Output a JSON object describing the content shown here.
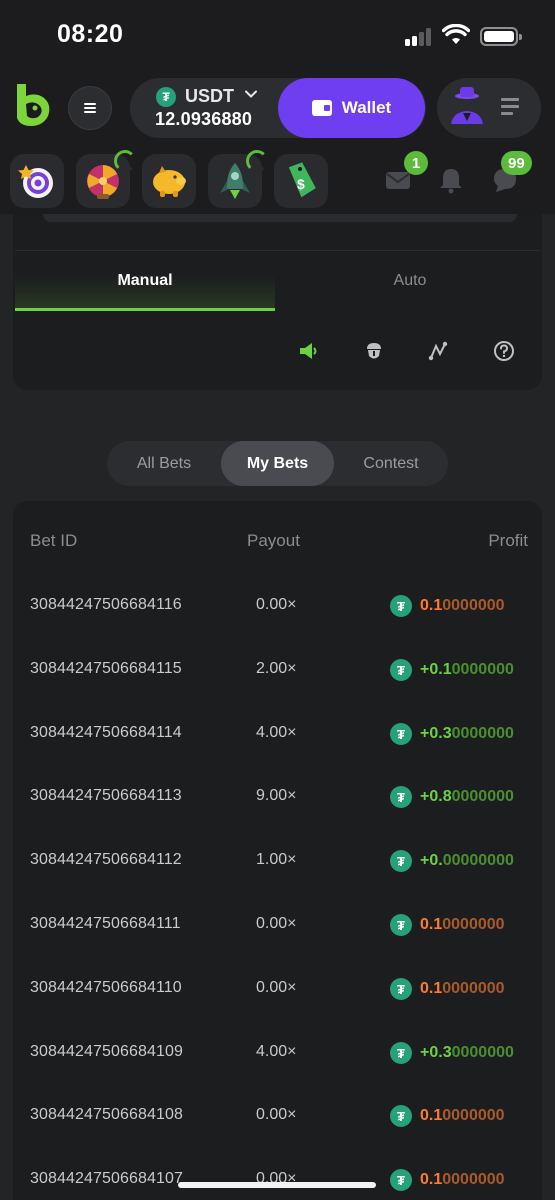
{
  "status_bar": {
    "time": "08:20"
  },
  "header": {
    "currency": "USDT",
    "balance": "12.0936880",
    "wallet_label": "Wallet",
    "colors": {
      "wallet": "#6f3ef0",
      "accent": "#6bd33f"
    }
  },
  "promos": {
    "icons": [
      "target-icon",
      "lucky-wheel-icon",
      "piggy-bank-icon",
      "rocket-icon",
      "price-tag-icon"
    ],
    "mail_badge": "1",
    "chat_badge": "99"
  },
  "game_panel": {
    "tabs": [
      {
        "label": "Manual",
        "active": true
      },
      {
        "label": "Auto",
        "active": false
      }
    ],
    "tools": [
      "sound-icon",
      "fairness-icon",
      "chart-icon",
      "help-icon"
    ]
  },
  "bets_tabs": [
    {
      "label": "All Bets",
      "active": false
    },
    {
      "label": "My Bets",
      "active": true
    },
    {
      "label": "Contest",
      "active": false
    }
  ],
  "table": {
    "headers": {
      "id": "Bet ID",
      "payout": "Payout",
      "profit": "Profit"
    },
    "rows": [
      {
        "id": "30844247506684116",
        "payout": "0.00×",
        "profit_main": "0.1",
        "profit_rest": "0000000",
        "win": false
      },
      {
        "id": "30844247506684115",
        "payout": "2.00×",
        "profit_main": "+0.1",
        "profit_rest": "0000000",
        "win": true
      },
      {
        "id": "30844247506684114",
        "payout": "4.00×",
        "profit_main": "+0.3",
        "profit_rest": "0000000",
        "win": true
      },
      {
        "id": "30844247506684113",
        "payout": "9.00×",
        "profit_main": "+0.8",
        "profit_rest": "0000000",
        "win": true
      },
      {
        "id": "30844247506684112",
        "payout": "1.00×",
        "profit_main": "+0.",
        "profit_rest": "00000000",
        "win": true
      },
      {
        "id": "30844247506684111",
        "payout": "0.00×",
        "profit_main": "0.1",
        "profit_rest": "0000000",
        "win": false
      },
      {
        "id": "30844247506684110",
        "payout": "0.00×",
        "profit_main": "0.1",
        "profit_rest": "0000000",
        "win": false
      },
      {
        "id": "30844247506684109",
        "payout": "4.00×",
        "profit_main": "+0.3",
        "profit_rest": "0000000",
        "win": true
      },
      {
        "id": "30844247506684108",
        "payout": "0.00×",
        "profit_main": "0.1",
        "profit_rest": "0000000",
        "win": false
      },
      {
        "id": "30844247506684107",
        "payout": "0.00×",
        "profit_main": "0.1",
        "profit_rest": "0000000",
        "win": false
      }
    ]
  }
}
